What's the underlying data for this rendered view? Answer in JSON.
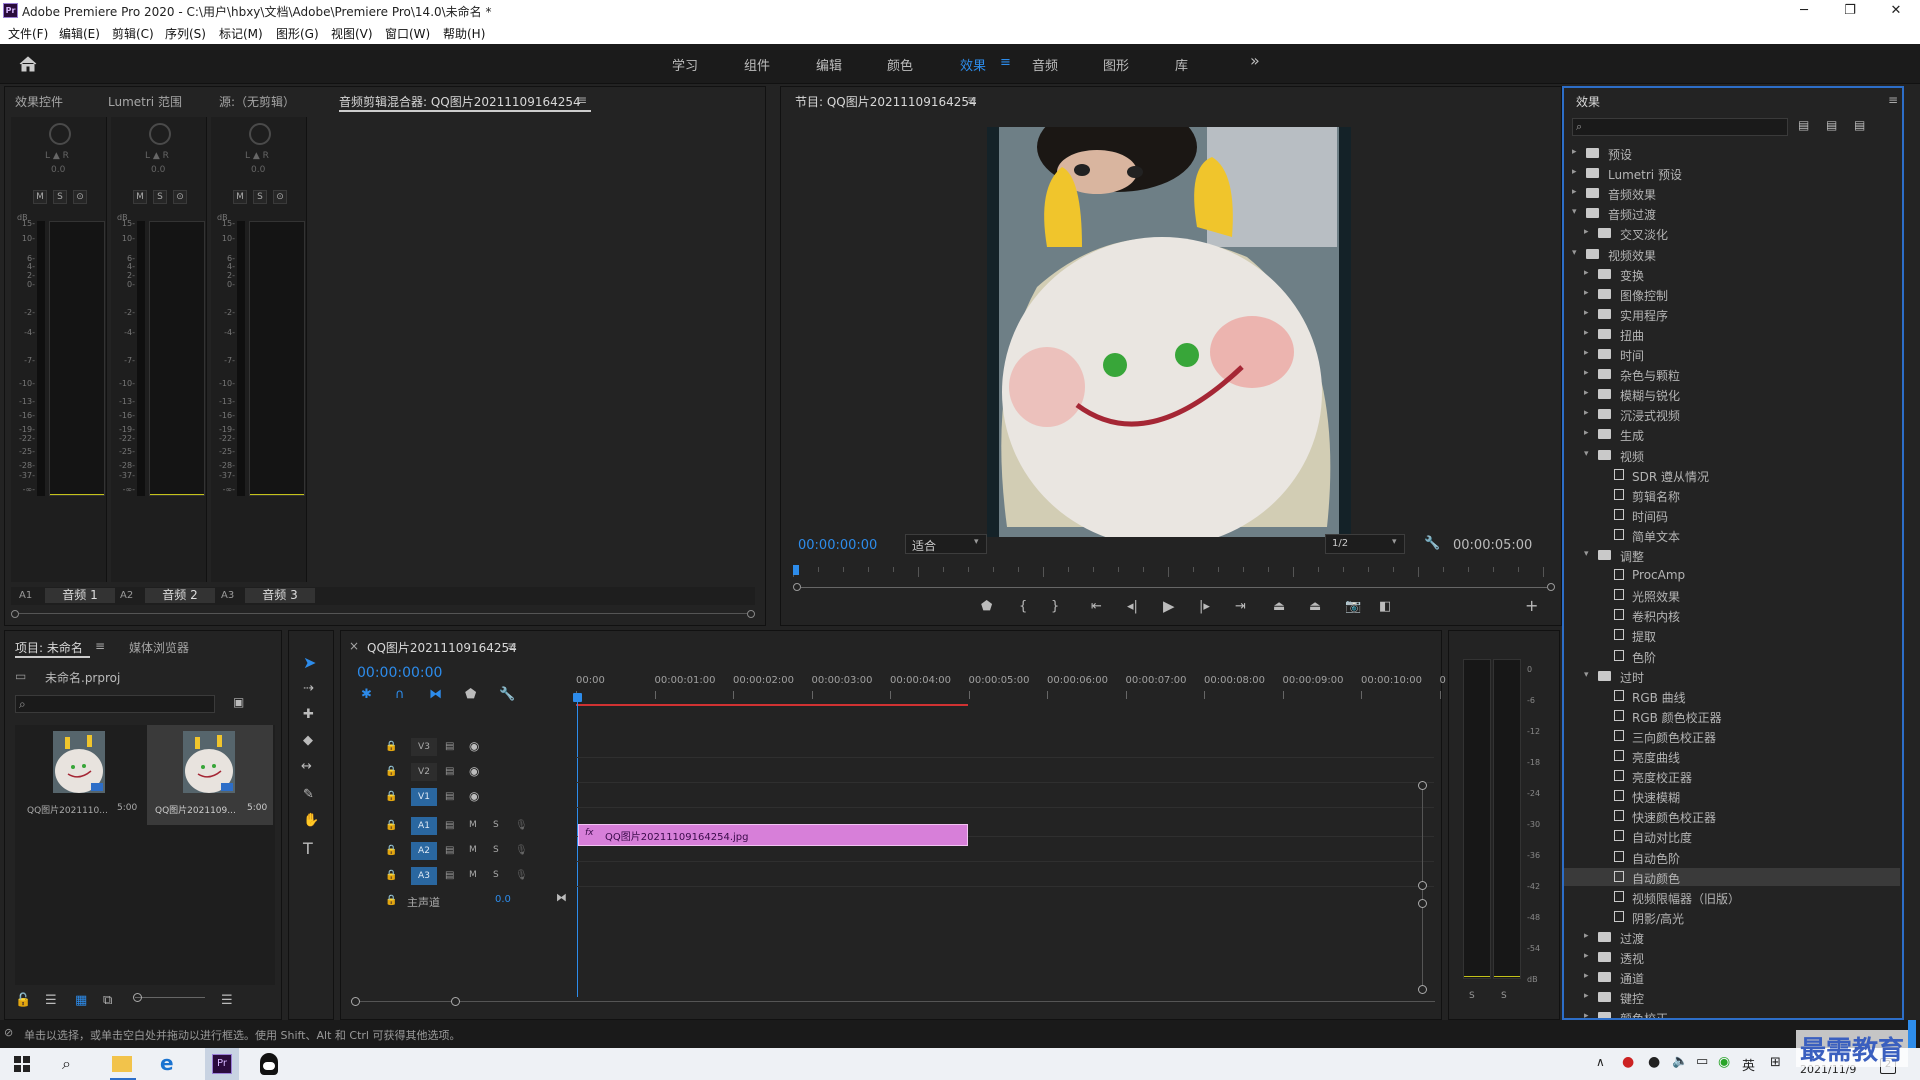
{
  "window": {
    "title": "Adobe Premiere Pro 2020 - C:\\用户\\hbxy\\文档\\Adobe\\Premiere Pro\\14.0\\未命名 *",
    "app_icon": "Pr",
    "minimize": "─",
    "restore": "❐",
    "close": "✕"
  },
  "menu": [
    "文件(F)",
    "编辑(E)",
    "剪辑(C)",
    "序列(S)",
    "标记(M)",
    "图形(G)",
    "视图(V)",
    "窗口(W)",
    "帮助(H)"
  ],
  "workspaces": {
    "items": [
      "学习",
      "组件",
      "编辑",
      "颜色",
      "效果",
      "音频",
      "图形",
      "库"
    ],
    "active": "效果",
    "more": "»"
  },
  "left_top_tabs": [
    "效果控件",
    "Lumetri 范围",
    "源:（无剪辑）",
    "音频剪辑混合器: QQ图片20211109164254"
  ],
  "mixer": {
    "channels": [
      {
        "id": "A1",
        "name": "音频 1",
        "pan_label": "L ▲ R",
        "pan_value": "0.0"
      },
      {
        "id": "A2",
        "name": "音频 2",
        "pan_label": "L ▲ R",
        "pan_value": "0.0"
      },
      {
        "id": "A3",
        "name": "音频 3",
        "pan_label": "L ▲ R",
        "pan_value": "0.0"
      }
    ],
    "buttons": [
      "M",
      "S",
      "⊙"
    ],
    "db_label": "dB",
    "scale": [
      "15-",
      "10-",
      "6-",
      "4-",
      "2-",
      "0-",
      "-2-",
      "-4-",
      "-7-",
      "-10-",
      "-13-",
      "-16-",
      "-19-",
      "-22-",
      "-25-",
      "-28-",
      "-37-",
      "-∞-"
    ]
  },
  "program": {
    "title": "节目: QQ图片20211109164254",
    "timecode": "00:00:00:00",
    "fit": "适合",
    "resolution": "1/2",
    "duration": "00:00:05:00"
  },
  "effects": {
    "title": "效果",
    "search_placeholder": "",
    "tree": [
      {
        "label": "预设",
        "level": 0,
        "type": "folder",
        "open": false
      },
      {
        "label": "Lumetri 预设",
        "level": 0,
        "type": "folder",
        "open": false
      },
      {
        "label": "音频效果",
        "level": 0,
        "type": "folder",
        "open": false
      },
      {
        "label": "音频过渡",
        "level": 0,
        "type": "folder",
        "open": true
      },
      {
        "label": "交叉淡化",
        "level": 1,
        "type": "folder",
        "open": false
      },
      {
        "label": "视频效果",
        "level": 0,
        "type": "folder",
        "open": true
      },
      {
        "label": "变换",
        "level": 1,
        "type": "folder",
        "open": false
      },
      {
        "label": "图像控制",
        "level": 1,
        "type": "folder",
        "open": false
      },
      {
        "label": "实用程序",
        "level": 1,
        "type": "folder",
        "open": false
      },
      {
        "label": "扭曲",
        "level": 1,
        "type": "folder",
        "open": false
      },
      {
        "label": "时间",
        "level": 1,
        "type": "folder",
        "open": false
      },
      {
        "label": "杂色与颗粒",
        "level": 1,
        "type": "folder",
        "open": false
      },
      {
        "label": "模糊与锐化",
        "level": 1,
        "type": "folder",
        "open": false
      },
      {
        "label": "沉浸式视频",
        "level": 1,
        "type": "folder",
        "open": false
      },
      {
        "label": "生成",
        "level": 1,
        "type": "folder",
        "open": false
      },
      {
        "label": "视频",
        "level": 1,
        "type": "folder",
        "open": true
      },
      {
        "label": "SDR 遵从情况",
        "level": 2,
        "type": "file"
      },
      {
        "label": "剪辑名称",
        "level": 2,
        "type": "file"
      },
      {
        "label": "时间码",
        "level": 2,
        "type": "file"
      },
      {
        "label": "简单文本",
        "level": 2,
        "type": "file"
      },
      {
        "label": "调整",
        "level": 1,
        "type": "folder",
        "open": true
      },
      {
        "label": "ProcAmp",
        "level": 2,
        "type": "file"
      },
      {
        "label": "光照效果",
        "level": 2,
        "type": "file"
      },
      {
        "label": "卷积内核",
        "level": 2,
        "type": "file"
      },
      {
        "label": "提取",
        "level": 2,
        "type": "file"
      },
      {
        "label": "色阶",
        "level": 2,
        "type": "file"
      },
      {
        "label": "过时",
        "level": 1,
        "type": "folder",
        "open": true
      },
      {
        "label": "RGB 曲线",
        "level": 2,
        "type": "file"
      },
      {
        "label": "RGB 颜色校正器",
        "level": 2,
        "type": "file"
      },
      {
        "label": "三向颜色校正器",
        "level": 2,
        "type": "file"
      },
      {
        "label": "亮度曲线",
        "level": 2,
        "type": "file"
      },
      {
        "label": "亮度校正器",
        "level": 2,
        "type": "file"
      },
      {
        "label": "快速模糊",
        "level": 2,
        "type": "file"
      },
      {
        "label": "快速颜色校正器",
        "level": 2,
        "type": "file"
      },
      {
        "label": "自动对比度",
        "level": 2,
        "type": "file"
      },
      {
        "label": "自动色阶",
        "level": 2,
        "type": "file"
      },
      {
        "label": "自动颜色",
        "level": 2,
        "type": "file",
        "selected": true
      },
      {
        "label": "视频限幅器（旧版）",
        "level": 2,
        "type": "file"
      },
      {
        "label": "阴影/高光",
        "level": 2,
        "type": "file"
      },
      {
        "label": "过渡",
        "level": 1,
        "type": "folder",
        "open": false
      },
      {
        "label": "透视",
        "level": 1,
        "type": "folder",
        "open": false
      },
      {
        "label": "通道",
        "level": 1,
        "type": "folder",
        "open": false
      },
      {
        "label": "键控",
        "level": 1,
        "type": "folder",
        "open": false
      },
      {
        "label": "颜色校正",
        "level": 1,
        "type": "folder",
        "open": false
      }
    ]
  },
  "project": {
    "tabs": [
      "项目: 未命名",
      "媒体浏览器"
    ],
    "file": "未命名.prproj",
    "search_placeholder": "",
    "items": [
      {
        "name": "QQ图片2021110...",
        "duration": "5:00"
      },
      {
        "name": "QQ图片2021109...",
        "duration": "5:00"
      }
    ]
  },
  "timeline": {
    "tab": "QQ图片20211109164254",
    "close": "×",
    "timecode": "00:00:00:00",
    "ruler": [
      "00:00",
      "00:00:01:00",
      "00:00:02:00",
      "00:00:03:00",
      "00:00:04:00",
      "00:00:05:00",
      "00:00:06:00",
      "00:00:07:00",
      "00:00:08:00",
      "00:00:09:00",
      "00:00:10:00",
      "0"
    ],
    "video_tracks": [
      "V3",
      "V2",
      "V1"
    ],
    "audio_tracks": [
      "A1",
      "A2",
      "A3"
    ],
    "track_m": "M",
    "track_s": "S",
    "master_label": "主声道",
    "master_value": "0.0",
    "clip_label": "QQ图片20211109164254.jpg",
    "clip_fx": "fx",
    "clip_color": "#d77fd9"
  },
  "audio_meter": {
    "scale": [
      "0",
      "-6",
      "-12",
      "-18",
      "-24",
      "-30",
      "-36",
      "-42",
      "-48",
      "-54",
      "dB"
    ],
    "solo": [
      "S",
      "S"
    ]
  },
  "status": "单击以选择，或单击空白处并拖动以进行框选。使用 Shift、Alt 和 Ctrl 可获得其他选项。",
  "taskbar": {
    "ime": "英",
    "date": "2021/11/9",
    "badge": "2",
    "watermark": "最需教育"
  }
}
